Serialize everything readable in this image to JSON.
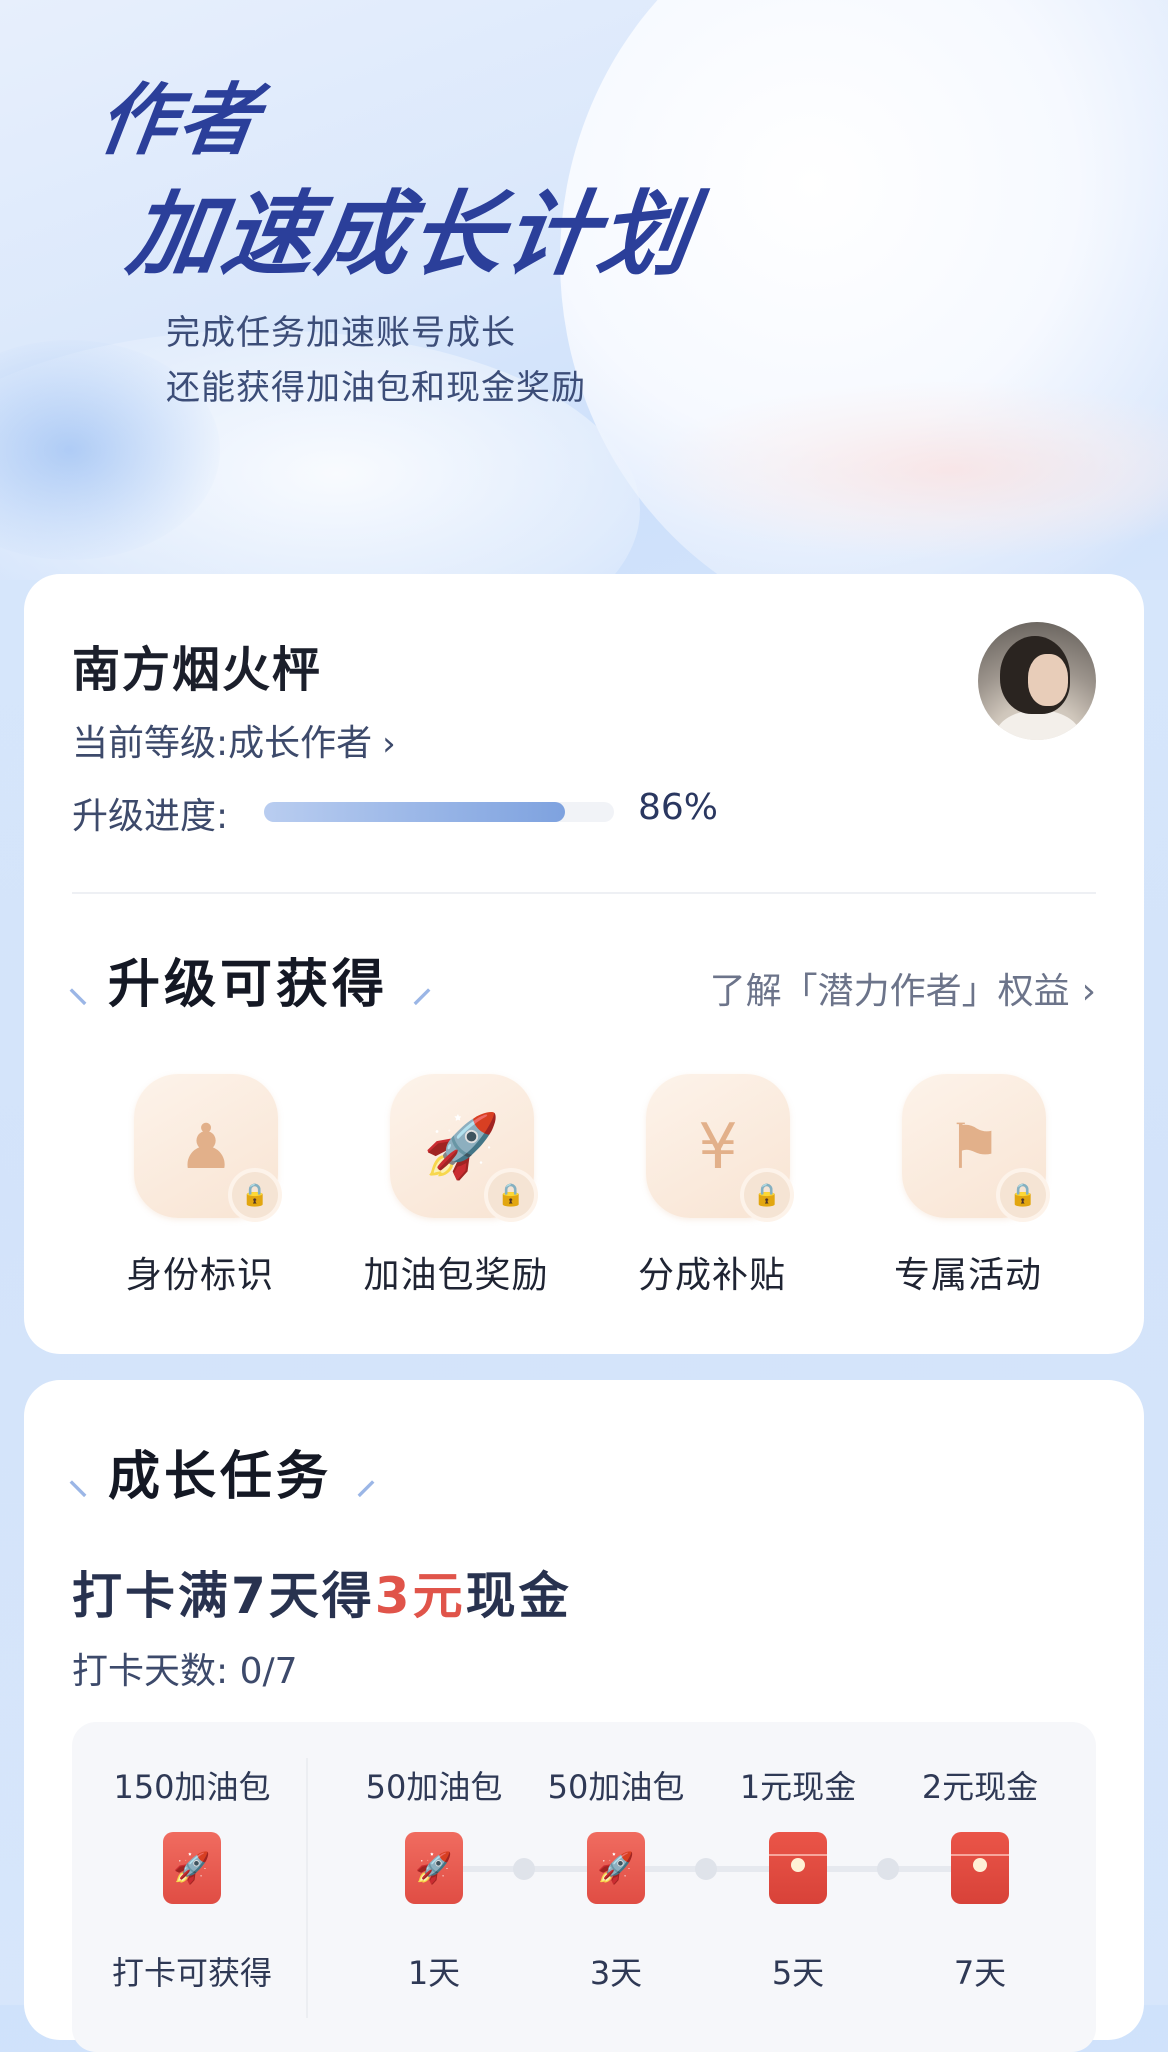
{
  "header": {
    "title_line1": "作者",
    "title_line2": "加速成长计划",
    "subtitle_line1": "完成任务加速账号成长",
    "subtitle_line2": "还能获得加油包和现金奖励"
  },
  "profile": {
    "username": "南方烟火枰",
    "level_text": "当前等级:成长作者",
    "level_arrow": "›",
    "progress_label": "升级进度:",
    "progress_value": 0.86,
    "progress_text": "86%"
  },
  "upgrade": {
    "title": "升级可获得",
    "link_text": "了解「潜力作者」权益",
    "link_arrow": "›",
    "benefits": [
      {
        "label": "身份标识",
        "icon": "user-star-icon",
        "glyph": "♟"
      },
      {
        "label": "加油包奖励",
        "icon": "rocket-icon",
        "glyph": "🚀"
      },
      {
        "label": "分成补贴",
        "icon": "yuan-coin-icon",
        "glyph": "¥"
      },
      {
        "label": "专属活动",
        "icon": "flag-icon",
        "glyph": "⚑"
      }
    ],
    "lock_icon": "lock-icon"
  },
  "tasks": {
    "title": "成长任务",
    "task_prefix": "打卡满7天得",
    "task_highlight": "3元",
    "task_suffix": "现金",
    "checkin_count": "打卡天数: 0/7",
    "rewards_first": {
      "top": "150加油包",
      "bottom": "打卡可获得"
    },
    "rewards": [
      {
        "top": "50加油包",
        "bottom": "1天",
        "kind": "fuel"
      },
      {
        "top": "50加油包",
        "bottom": "3天",
        "kind": "fuel"
      },
      {
        "top": "1元现金",
        "bottom": "5天",
        "kind": "cash"
      },
      {
        "top": "2元现金",
        "bottom": "7天",
        "kind": "cash"
      }
    ]
  },
  "colors": {
    "accent_red": "#e0544a",
    "progress_blue": "#7ea2df",
    "title_navy": "#2b3f9a"
  }
}
